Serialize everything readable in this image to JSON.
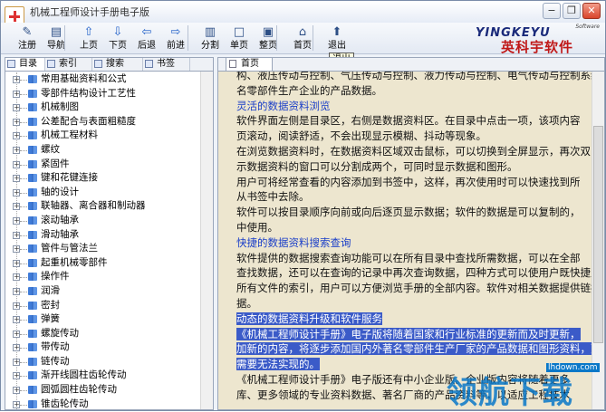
{
  "window": {
    "title": "机械工程师设计手册电子版",
    "buttons": {
      "minimize": "−",
      "restore": "❐",
      "close": "✕"
    }
  },
  "toolbar": {
    "items": [
      {
        "label": "注册",
        "icon": "register-icon",
        "glyph": "✎"
      },
      {
        "label": "导航",
        "icon": "nav-icon",
        "glyph": "▤"
      },
      {
        "label": "上页",
        "icon": "arrow-up-icon",
        "glyph": "⇧"
      },
      {
        "label": "下页",
        "icon": "arrow-down-icon",
        "glyph": "⇩"
      },
      {
        "label": "后退",
        "icon": "arrow-left-icon",
        "glyph": "⇦"
      },
      {
        "label": "前进",
        "icon": "arrow-right-icon",
        "glyph": "⇨"
      },
      {
        "label": "分割",
        "icon": "split-icon",
        "glyph": "▥"
      },
      {
        "label": "单页",
        "icon": "single-page-icon",
        "glyph": "□"
      },
      {
        "label": "整页",
        "icon": "full-page-icon",
        "glyph": "▣"
      },
      {
        "label": "首页",
        "icon": "home-icon",
        "glyph": "⌂"
      },
      {
        "label": "退出",
        "icon": "exit-icon",
        "glyph": "⬆"
      }
    ],
    "tooltip": "退出"
  },
  "logo": {
    "small": "Software",
    "en": "YINGKEYU",
    "cn": "英科宇软件"
  },
  "left_tabs": [
    "目录",
    "索引",
    "搜索",
    "书签"
  ],
  "tree": [
    "常用基础资料和公式",
    "零部件结构设计工艺性",
    "机械制图",
    "公差配合与表面粗糙度",
    "机械工程材料",
    "螺纹",
    "紧固件",
    "键和花键连接",
    "轴的设计",
    "联轴器、离合器和制动器",
    "滚动轴承",
    "滑动轴承",
    "管件与管法兰",
    "起重机械零部件",
    "操作件",
    "润滑",
    "密封",
    "弹簧",
    "螺旋传动",
    "带传动",
    "链传动",
    "渐开线圆柱齿轮传动",
    "圆弧圆柱齿轮传动",
    "锥齿轮传动"
  ],
  "content_tab": "首页",
  "content_lines": [
    {
      "text": "构、液压传动与控制、气压传动与控制、液力传动与控制、电气传动与控制系统、",
      "style": "normal"
    },
    {
      "text": "名零部件生产企业的产品数据。",
      "style": "normal"
    },
    {
      "text": "    灵活的数据资料浏览",
      "style": "head"
    },
    {
      "text": "    软件界面左侧是目录区，右侧是数据资料区。在目录中点击一项，该项内容",
      "style": "normal"
    },
    {
      "text": "页滚动，阅读舒适，不会出现显示模糊、抖动等现象。",
      "style": "normal"
    },
    {
      "text": "    在浏览数据资料时，在数据资料区域双击鼠标，可以切换到全屏显示，再次双",
      "style": "normal"
    },
    {
      "text": "示数据资料的窗口可以分割成两个，可同时显示数据和图形。",
      "style": "normal"
    },
    {
      "text": "    用户可将经常查看的内容添加到书签中，这样，再次使用时可以快速找到所",
      "style": "normal"
    },
    {
      "text": "从书签中去除。",
      "style": "normal"
    },
    {
      "text": "    软件可以按目录顺序向前或向后逐页显示数据；软件的数据是可以复制的，",
      "style": "normal"
    },
    {
      "text": "中使用。",
      "style": "normal"
    },
    {
      "text": "    快捷的数据资料搜索查询",
      "style": "head"
    },
    {
      "text": "    软件提供的数据搜索查询功能可以在所有目录中查找所需数据，可以在全部",
      "style": "normal"
    },
    {
      "text": "查找数据，还可以在查询的记录中再次查询数据，四种方式可以使用户既快捷又",
      "style": "normal"
    },
    {
      "text": "所有文件的索引，用户可以方便浏览手册的全部内容。软件对相关数据提供链接",
      "style": "normal"
    },
    {
      "text": "据。",
      "style": "normal"
    },
    {
      "text": "    动态的数据资料升级和软件服务",
      "style": "sel"
    },
    {
      "text": "    《机械工程师设计手册》电子版将随着国家和行业标准的更新而及时更新，",
      "style": "sel"
    },
    {
      "text": "加新的内容，将逐步添加国内外著名零部件生产厂家的产品数据和图形资料，更",
      "style": "sel"
    },
    {
      "text": "需要无法实现的。",
      "style": "sel"
    },
    {
      "text": "    《机械工程师设计手册》电子版还有中小企业版。企业版内容将随着更多",
      "style": "normal"
    },
    {
      "text": "库、更多领域的专业资料数据、著名厂商的产品资料等，以适应工程技术",
      "style": "normal"
    }
  ],
  "watermark": {
    "big": "领航下载",
    "small": "lhdown.com"
  }
}
